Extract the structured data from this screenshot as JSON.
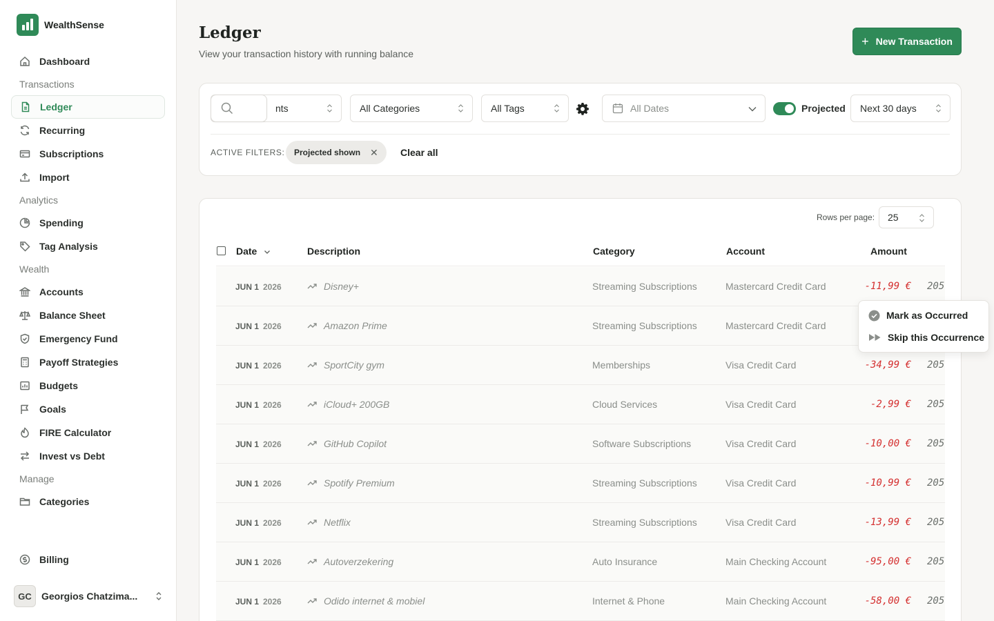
{
  "brand": {
    "name": "WealthSense"
  },
  "sidebar": {
    "items": [
      {
        "type": "item",
        "label": "Dashboard",
        "icon": "home-icon"
      },
      {
        "type": "section",
        "label": "Transactions"
      },
      {
        "type": "item",
        "label": "Ledger",
        "icon": "document-icon",
        "active": true
      },
      {
        "type": "item",
        "label": "Recurring",
        "icon": "refresh-icon"
      },
      {
        "type": "item",
        "label": "Subscriptions",
        "icon": "credit-card-icon"
      },
      {
        "type": "item",
        "label": "Import",
        "icon": "upload-icon"
      },
      {
        "type": "section",
        "label": "Analytics"
      },
      {
        "type": "item",
        "label": "Spending",
        "icon": "pie-chart-icon"
      },
      {
        "type": "item",
        "label": "Tag Analysis",
        "icon": "tag-icon"
      },
      {
        "type": "section",
        "label": "Wealth"
      },
      {
        "type": "item",
        "label": "Accounts",
        "icon": "bank-icon"
      },
      {
        "type": "item",
        "label": "Balance Sheet",
        "icon": "scale-icon"
      },
      {
        "type": "item",
        "label": "Emergency Fund",
        "icon": "shield-icon"
      },
      {
        "type": "item",
        "label": "Payoff Strategies",
        "icon": "calculator-icon"
      },
      {
        "type": "item",
        "label": "Budgets",
        "icon": "wallet-icon"
      },
      {
        "type": "item",
        "label": "Goals",
        "icon": "flag-icon"
      },
      {
        "type": "item",
        "label": "FIRE Calculator",
        "icon": "flame-icon"
      },
      {
        "type": "item",
        "label": "Invest vs Debt",
        "icon": "arrows-icon"
      },
      {
        "type": "section",
        "label": "Manage"
      },
      {
        "type": "item",
        "label": "Categories",
        "icon": "folder-icon"
      }
    ],
    "billing": "Billing",
    "user": {
      "initials": "GC",
      "name": "Georgios Chatzima..."
    }
  },
  "header": {
    "title": "Ledger",
    "subtitle": "View your transaction history with running balance",
    "new_button": "New Transaction"
  },
  "filters": {
    "accounts": "nts",
    "categories": "All Categories",
    "tags": "All Tags",
    "dates_placeholder": "All Dates",
    "projected_label": "Projected",
    "projected_on": true,
    "range": "Next 30 days",
    "active_label": "ACTIVE FILTERS:",
    "chip": "Projected shown",
    "clear_all": "Clear all"
  },
  "table": {
    "rows_per_page_label": "Rows per page:",
    "rows_per_page": "25",
    "columns": {
      "date": "Date",
      "description": "Description",
      "category": "Category",
      "account": "Account",
      "amount": "Amount"
    },
    "rows": [
      {
        "month": "JUN 1",
        "year": "2026",
        "description": "Disney+",
        "category": "Streaming Subscriptions",
        "account": "Mastercard Credit Card",
        "amount": "-11,99 €",
        "balance": "205"
      },
      {
        "month": "JUN 1",
        "year": "2026",
        "description": "Amazon Prime",
        "category": "Streaming Subscriptions",
        "account": "Mastercard Credit Card",
        "amount": "",
        "balance": ""
      },
      {
        "month": "JUN 1",
        "year": "2026",
        "description": "SportCity gym",
        "category": "Memberships",
        "account": "Visa Credit Card",
        "amount": "-34,99 €",
        "balance": "205"
      },
      {
        "month": "JUN 1",
        "year": "2026",
        "description": "iCloud+ 200GB",
        "category": "Cloud Services",
        "account": "Visa Credit Card",
        "amount": "-2,99 €",
        "balance": "205"
      },
      {
        "month": "JUN 1",
        "year": "2026",
        "description": "GitHub Copilot",
        "category": "Software Subscriptions",
        "account": "Visa Credit Card",
        "amount": "-10,00 €",
        "balance": "205"
      },
      {
        "month": "JUN 1",
        "year": "2026",
        "description": "Spotify Premium",
        "category": "Streaming Subscriptions",
        "account": "Visa Credit Card",
        "amount": "-10,99 €",
        "balance": "205"
      },
      {
        "month": "JUN 1",
        "year": "2026",
        "description": "Netflix",
        "category": "Streaming Subscriptions",
        "account": "Visa Credit Card",
        "amount": "-13,99 €",
        "balance": "205"
      },
      {
        "month": "JUN 1",
        "year": "2026",
        "description": "Autoverzekering",
        "category": "Auto Insurance",
        "account": "Main Checking Account",
        "amount": "-95,00 €",
        "balance": "205"
      },
      {
        "month": "JUN 1",
        "year": "2026",
        "description": "Odido internet & mobiel",
        "category": "Internet & Phone",
        "account": "Main Checking Account",
        "amount": "-58,00 €",
        "balance": "205"
      }
    ]
  },
  "context_menu": {
    "mark_occurred": "Mark as Occurred",
    "skip": "Skip this Occurrence"
  },
  "colors": {
    "accent": "#2f8a58",
    "negative": "#d42f2f"
  }
}
